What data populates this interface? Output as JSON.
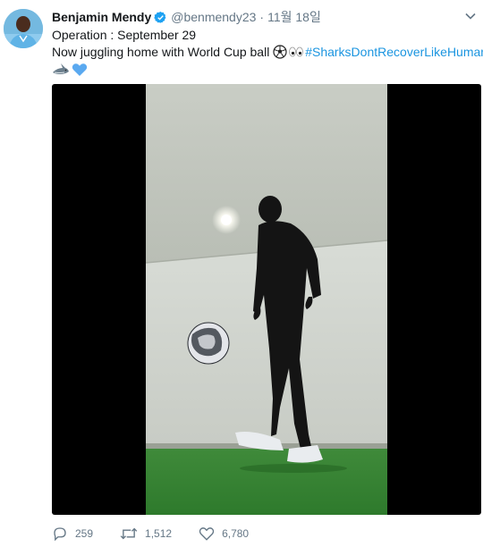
{
  "author": {
    "name": "Benjamin Mendy",
    "handle": "@benmendy23",
    "separator": "·",
    "time": "11월 18일"
  },
  "tweet": {
    "line1": "Operation : September 29",
    "line2_text": "Now juggling home with World Cup ball ",
    "hashtag": "#SharksDontRecoverLikeHumans",
    "icons": [
      "soccer-ball-icon",
      "eyes-icon",
      "shark-icon",
      "blue-heart-icon"
    ]
  },
  "actions": {
    "replies": "259",
    "retweets": "1,512",
    "likes": "6,780"
  },
  "colors": {
    "link": "#1b95e0",
    "meta": "#657786",
    "verified": "#1da1f2",
    "heart": "#5aa9f0"
  }
}
